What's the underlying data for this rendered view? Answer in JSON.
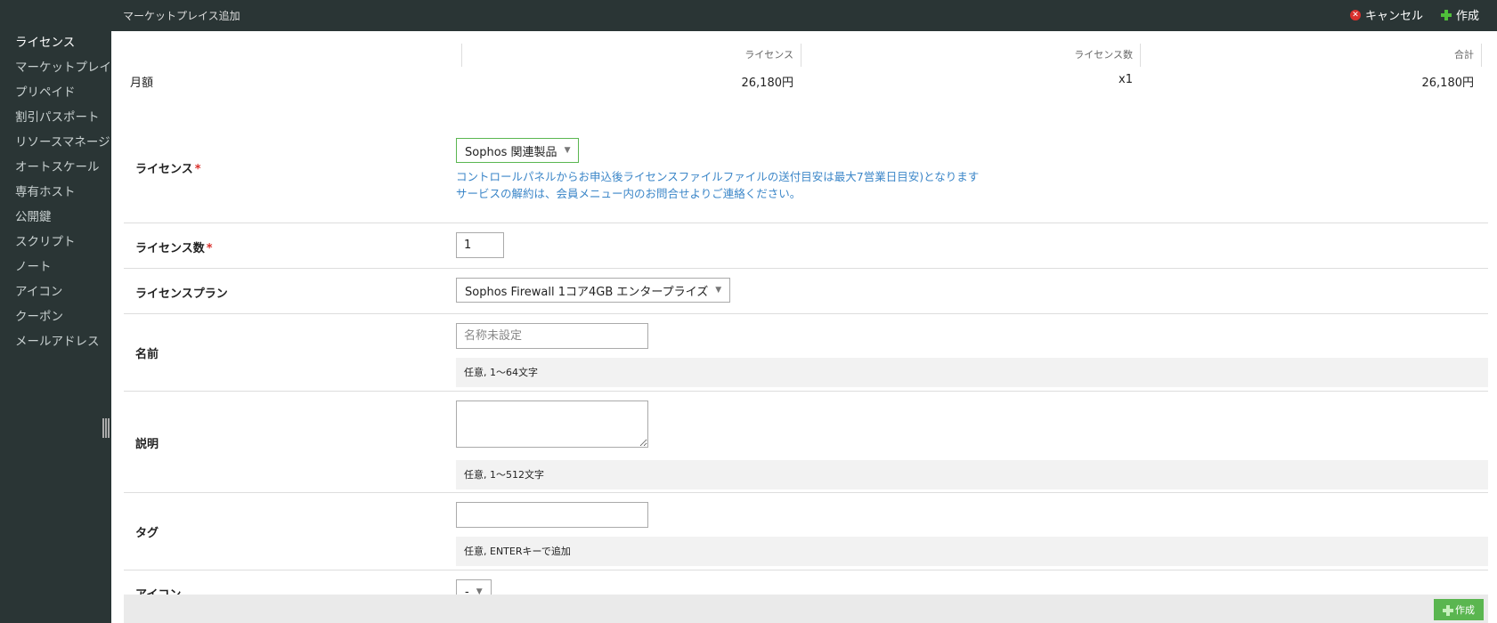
{
  "header": {
    "title": "マーケットプレイス追加",
    "cancel_label": "キャンセル",
    "create_label": "作成"
  },
  "sidebar": {
    "items": [
      {
        "label": "ライセンス",
        "active": true
      },
      {
        "label": "マーケットプレイス"
      },
      {
        "label": "プリペイド"
      },
      {
        "label": "割引パスポート"
      },
      {
        "label": "リソースマネージャ"
      },
      {
        "label": "オートスケール"
      },
      {
        "label": "専有ホスト"
      },
      {
        "label": "公開鍵"
      },
      {
        "label": "スクリプト"
      },
      {
        "label": "ノート"
      },
      {
        "label": "アイコン"
      },
      {
        "label": "クーポン"
      },
      {
        "label": "メールアドレス"
      }
    ]
  },
  "price": {
    "headers": {
      "license": "ライセンス",
      "count": "ライセンス数",
      "total": "合計"
    },
    "row_label": "月額",
    "license_value": "26,180円",
    "count_value": "x1",
    "total_value": "26,180円"
  },
  "form": {
    "license": {
      "label": "ライセンス",
      "required_mark": "*",
      "selected": "Sophos 関連製品",
      "info_line1": "コントロールパネルからお申込後ライセンスファイルファイルの送付目安は最大7営業日目安)となります",
      "info_line2": "サービスの解約は、会員メニュー内のお問合せよりご連絡ください。"
    },
    "count": {
      "label": "ライセンス数",
      "required_mark": "*",
      "value": "1"
    },
    "plan": {
      "label": "ライセンスプラン",
      "selected": "Sophos Firewall 1コア4GB エンタープライズ"
    },
    "name": {
      "label": "名前",
      "placeholder": "名称未設定",
      "value": "",
      "hint": "任意, 1～64文字"
    },
    "description": {
      "label": "説明",
      "value": "",
      "hint": "任意, 1～512文字"
    },
    "tags": {
      "label": "タグ",
      "value": "",
      "hint": "任意, ENTERキーで追加"
    },
    "icon": {
      "label": "アイコン",
      "selected": "-"
    }
  },
  "footer": {
    "create_label": "作成"
  },
  "colors": {
    "accent_green": "#5ab650",
    "link_blue": "#3b86c8",
    "required_red": "#d9302c",
    "sidebar_bg": "#2a3535"
  }
}
